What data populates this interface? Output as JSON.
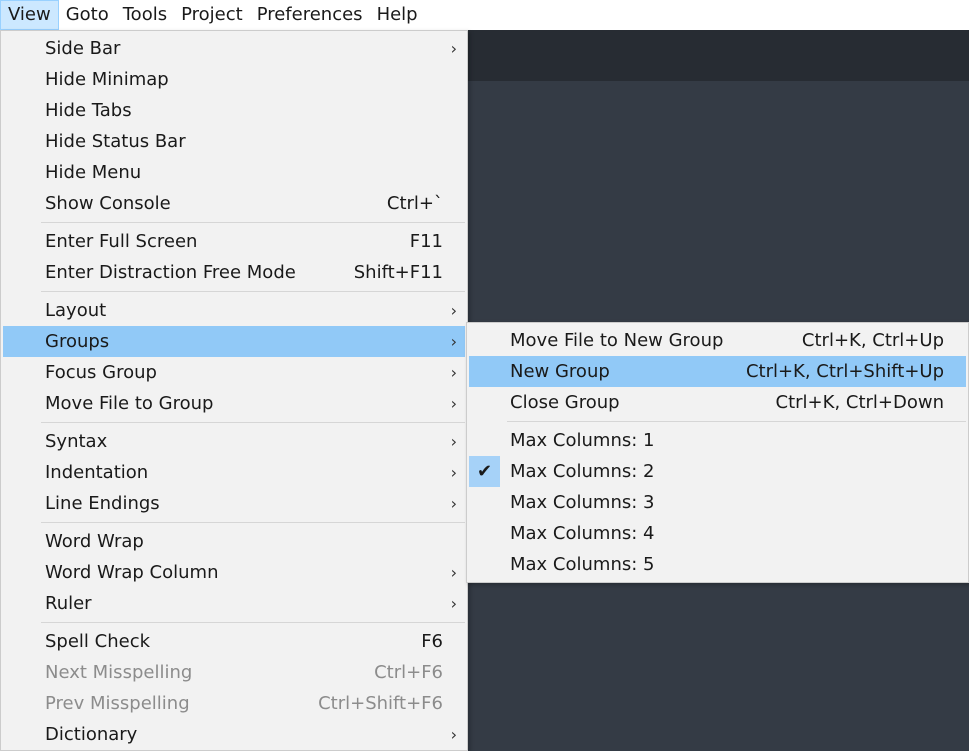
{
  "menubar": {
    "items": [
      {
        "label": "View",
        "active": true
      },
      {
        "label": "Goto"
      },
      {
        "label": "Tools"
      },
      {
        "label": "Project"
      },
      {
        "label": "Preferences"
      },
      {
        "label": "Help"
      }
    ]
  },
  "view_menu": {
    "side_bar": "Side Bar",
    "hide_minimap": "Hide Minimap",
    "hide_tabs": "Hide Tabs",
    "hide_status_bar": "Hide Status Bar",
    "hide_menu": "Hide Menu",
    "show_console": "Show Console",
    "show_console_shortcut": "Ctrl+`",
    "enter_full_screen": "Enter Full Screen",
    "enter_full_screen_shortcut": "F11",
    "distraction_free": "Enter Distraction Free Mode",
    "distraction_free_shortcut": "Shift+F11",
    "layout": "Layout",
    "groups": "Groups",
    "focus_group": "Focus Group",
    "move_file_to_group": "Move File to Group",
    "syntax": "Syntax",
    "indentation": "Indentation",
    "line_endings": "Line Endings",
    "word_wrap": "Word Wrap",
    "word_wrap_column": "Word Wrap Column",
    "ruler": "Ruler",
    "spell_check": "Spell Check",
    "spell_check_shortcut": "F6",
    "next_misspelling": "Next Misspelling",
    "next_misspelling_shortcut": "Ctrl+F6",
    "prev_misspelling": "Prev Misspelling",
    "prev_misspelling_shortcut": "Ctrl+Shift+F6",
    "dictionary": "Dictionary"
  },
  "groups_submenu": {
    "move_file_to_new_group": "Move File to New Group",
    "move_file_to_new_group_shortcut": "Ctrl+K, Ctrl+Up",
    "new_group": "New Group",
    "new_group_shortcut": "Ctrl+K, Ctrl+Shift+Up",
    "close_group": "Close Group",
    "close_group_shortcut": "Ctrl+K, Ctrl+Down",
    "max_columns_1": "Max Columns: 1",
    "max_columns_2": "Max Columns: 2",
    "max_columns_3": "Max Columns: 3",
    "max_columns_4": "Max Columns: 4",
    "max_columns_5": "Max Columns: 5",
    "checked": "Max Columns: 2"
  },
  "icons": {
    "submenu_arrow": "chevron-right-icon",
    "check": "check-icon"
  },
  "colors": {
    "highlight": "#91c9f7",
    "menubar_active": "#cce8ff",
    "editor_background": "#343b45",
    "editor_tabbar": "#272c33"
  }
}
